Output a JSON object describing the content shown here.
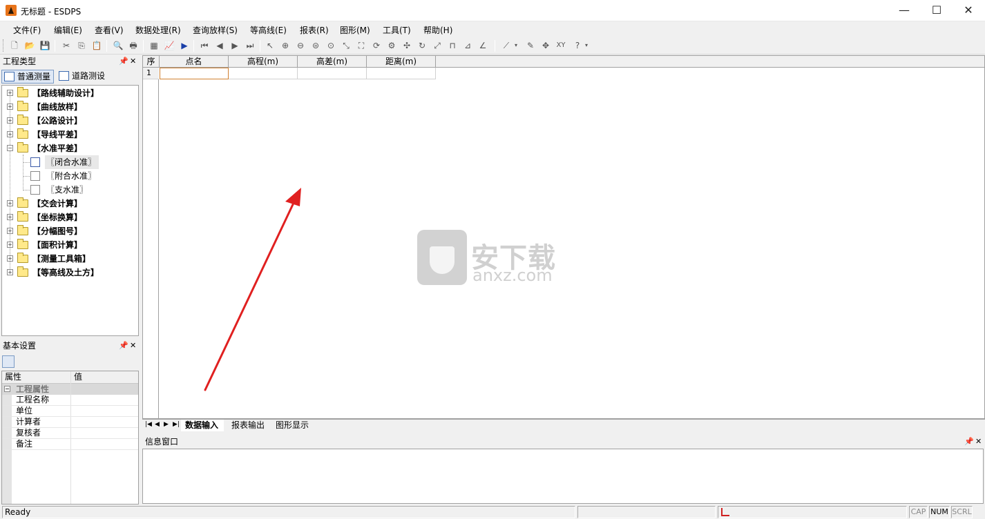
{
  "window": {
    "title": "无标题 - ESDPS",
    "minimize": "—",
    "maximize": "☐",
    "close": "✕"
  },
  "menu": [
    "文件(F)",
    "编辑(E)",
    "查看(V)",
    "数据处理(R)",
    "查询放样(S)",
    "等高线(E)",
    "报表(R)",
    "图形(M)",
    "工具(T)",
    "帮助(H)"
  ],
  "left_panel": {
    "title": "工程类型",
    "tabs": [
      "普通测量",
      "道路测设"
    ],
    "tree": [
      {
        "label": "【路线辅助设计】",
        "expanded": false
      },
      {
        "label": "【曲线放样】",
        "expanded": false
      },
      {
        "label": "【公路设计】",
        "expanded": false
      },
      {
        "label": "【导线平差】",
        "expanded": false
      },
      {
        "label": "【水准平差】",
        "expanded": true,
        "children": [
          "〖闭合水准〗",
          "〖附合水准〗",
          "〖支水准〗"
        ]
      },
      {
        "label": "【交会计算】",
        "expanded": false
      },
      {
        "label": "【坐标换算】",
        "expanded": false
      },
      {
        "label": "【分幅图号】",
        "expanded": false
      },
      {
        "label": "【面积计算】",
        "expanded": false
      },
      {
        "label": "【测量工具箱】",
        "expanded": false
      },
      {
        "label": "【等高线及土方】",
        "expanded": false
      }
    ]
  },
  "settings_panel": {
    "title": "基本设置",
    "columns": [
      "属性",
      "值"
    ],
    "category": "工程属性",
    "rows": [
      "工程名称",
      "单位",
      "计算者",
      "复核者",
      "备注"
    ]
  },
  "grid": {
    "columns": [
      "序",
      "点名",
      "高程(m)",
      "高差(m)",
      "距离(m)"
    ],
    "rows": [
      "1"
    ]
  },
  "sheet_tabs": [
    "数据输入",
    "报表输出",
    "图形显示"
  ],
  "info_panel": {
    "title": "信息窗口"
  },
  "status": {
    "text": "Ready",
    "indicators": [
      "CAP",
      "NUM",
      "SCRL"
    ]
  },
  "watermark": {
    "main": "安下载",
    "sub": "anxz.com"
  },
  "colors": {
    "arrow": "#e02020",
    "selection": "#d08030",
    "tab_active_border": "#7a9ac4"
  }
}
